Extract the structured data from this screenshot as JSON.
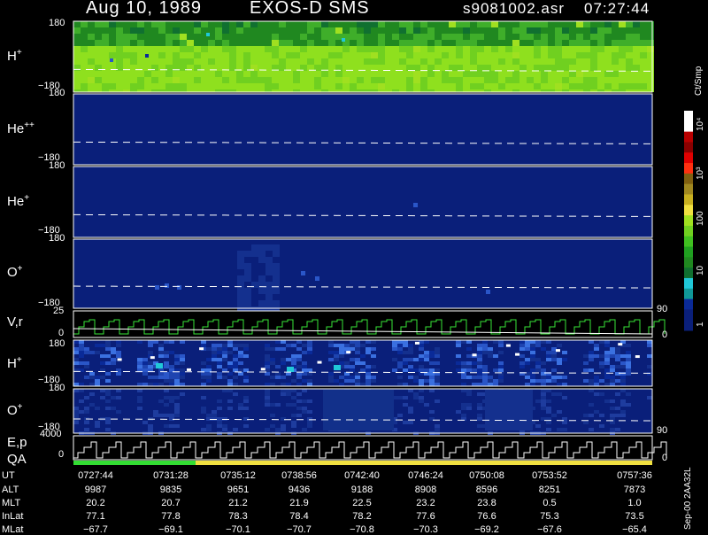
{
  "header": {
    "date": "Aug 10, 1989",
    "instrument": "EXOS-D SMS",
    "file": "s9081002.asr",
    "time": "07:27:44"
  },
  "colors": {
    "background": "#000000",
    "low": "#0a1f7a",
    "mid_blue": "#2a56c8",
    "cyan": "#20c8d8",
    "green": "#3fae2a",
    "light_green": "#8fe01e",
    "trace": "#39e639",
    "qa_good": "#33dd33",
    "qa_caution": "#f0e040"
  },
  "panels": [
    {
      "id": "hplus_top",
      "label": "H",
      "sup": "+",
      "ytop": "180",
      "ybot": "−180"
    },
    {
      "id": "hepp",
      "label": "He",
      "sup": "++",
      "ytop": "180",
      "ybot": "−180"
    },
    {
      "id": "heplus",
      "label": "He",
      "sup": "+",
      "ytop": "180",
      "ybot": "−180"
    },
    {
      "id": "oplus_top",
      "label": "O",
      "sup": "+",
      "ytop": "180",
      "ybot": "−180"
    },
    {
      "id": "vr",
      "label": "V,r",
      "sup": "",
      "ytop": "25",
      "ybot": "0"
    },
    {
      "id": "hplus_low",
      "label": "H",
      "sup": "+",
      "ytop": "180",
      "ybot": "−180"
    },
    {
      "id": "oplus_low",
      "label": "O",
      "sup": "+",
      "ytop": "180",
      "ybot": "−180"
    },
    {
      "id": "ep",
      "label": "E,p",
      "sup": "",
      "ytop": "4000",
      "ybot": "0"
    }
  ],
  "qa_label": "QA",
  "right_axes": {
    "vr": {
      "top": "90",
      "bottom": "0"
    },
    "ep": {
      "top": "90",
      "bottom": "0"
    }
  },
  "colorbar": {
    "unit": "Ct/Smp",
    "ticks": [
      "10⁴",
      "10³",
      "100",
      "10",
      "1"
    ],
    "colors": [
      "#ffffff",
      "#ffffff",
      "#b80000",
      "#8a0000",
      "#e00000",
      "#ff3010",
      "#806010",
      "#a08820",
      "#c8b020",
      "#f0e040",
      "#a0e020",
      "#70d020",
      "#40c020",
      "#20a020",
      "#208820",
      "#107030",
      "#20c8d8",
      "#109898",
      "#0a2a98",
      "#0a1f7a",
      "#0a1f7a"
    ]
  },
  "footer": {
    "rows": [
      {
        "label": "UT",
        "values": [
          "0727:44",
          "0731:28",
          "0735:12",
          "0738:56",
          "0742:40",
          "0746:24",
          "0750:08",
          "0753:52",
          "0757:36"
        ]
      },
      {
        "label": "ALT",
        "values": [
          "9987",
          "9835",
          "9651",
          "9436",
          "9188",
          "8908",
          "8596",
          "8251",
          "7873"
        ]
      },
      {
        "label": "MLT",
        "values": [
          "20.2",
          "20.7",
          "21.2",
          "21.9",
          "22.5",
          "23.2",
          "23.8",
          "0.5",
          "1.0"
        ]
      },
      {
        "label": "InLat",
        "values": [
          "77.1",
          "77.8",
          "78.3",
          "78.4",
          "78.2",
          "77.6",
          "76.6",
          "75.3",
          "73.5"
        ]
      },
      {
        "label": "MLat",
        "values": [
          "−67.7",
          "−69.1",
          "−70.1",
          "−70.7",
          "−70.8",
          "−70.3",
          "−69.2",
          "−67.6",
          "−65.4"
        ]
      }
    ],
    "stamp": "Sep-00  2AA32L"
  }
}
